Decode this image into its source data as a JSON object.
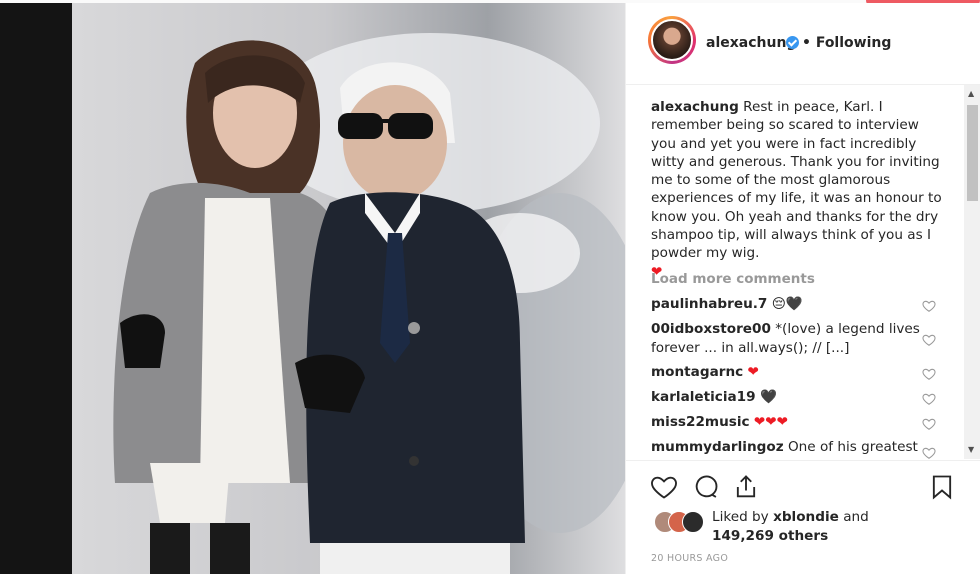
{
  "post": {
    "username": "alexachung",
    "following_label": "• Following",
    "caption_text": "Rest in peace, Karl. I remember being so scared to interview you and yet you were in fact incredibly witty and generous. Thank you for inviting me to some of the most glamorous experiences of my life, it was an honour to know you. Oh yeah and thanks for the dry shampoo tip, will always think of you as I powder my wig.",
    "caption_emoji": "❤",
    "load_more": "Load more comments",
    "comments": [
      {
        "user": "paulinhabreu.7",
        "text": "",
        "emoji": "😔🖤"
      },
      {
        "user": "00idboxstore00",
        "text": "*(love) a legend lives forever ... in all.ways(); // [...]",
        "emoji": ""
      },
      {
        "user": "montagarnc",
        "text": "",
        "emoji": "❤"
      },
      {
        "user": "karlaleticia19",
        "text": "",
        "emoji": "🖤"
      },
      {
        "user": "miss22music",
        "text": "",
        "emoji": "❤❤❤"
      },
      {
        "user": "mummydarlingoz",
        "text": "One of his greatest",
        "emoji": ""
      }
    ],
    "liked_by_prefix": "Liked by",
    "liked_by_user": "xblondie",
    "liked_by_and": "and",
    "liked_by_count": "149,269 others",
    "timestamp": "20 HOURS AGO"
  },
  "icons": {
    "heart": "heart-icon",
    "comment": "comment-icon",
    "share": "share-icon",
    "bookmark": "bookmark-icon",
    "verified": "verified-badge-icon",
    "scroll_up": "▲",
    "scroll_down": "▼"
  },
  "colors": {
    "verified": "#3897f0",
    "heart": "#ed1b24",
    "muted": "#999999",
    "accent_button": "#ee5a62"
  }
}
